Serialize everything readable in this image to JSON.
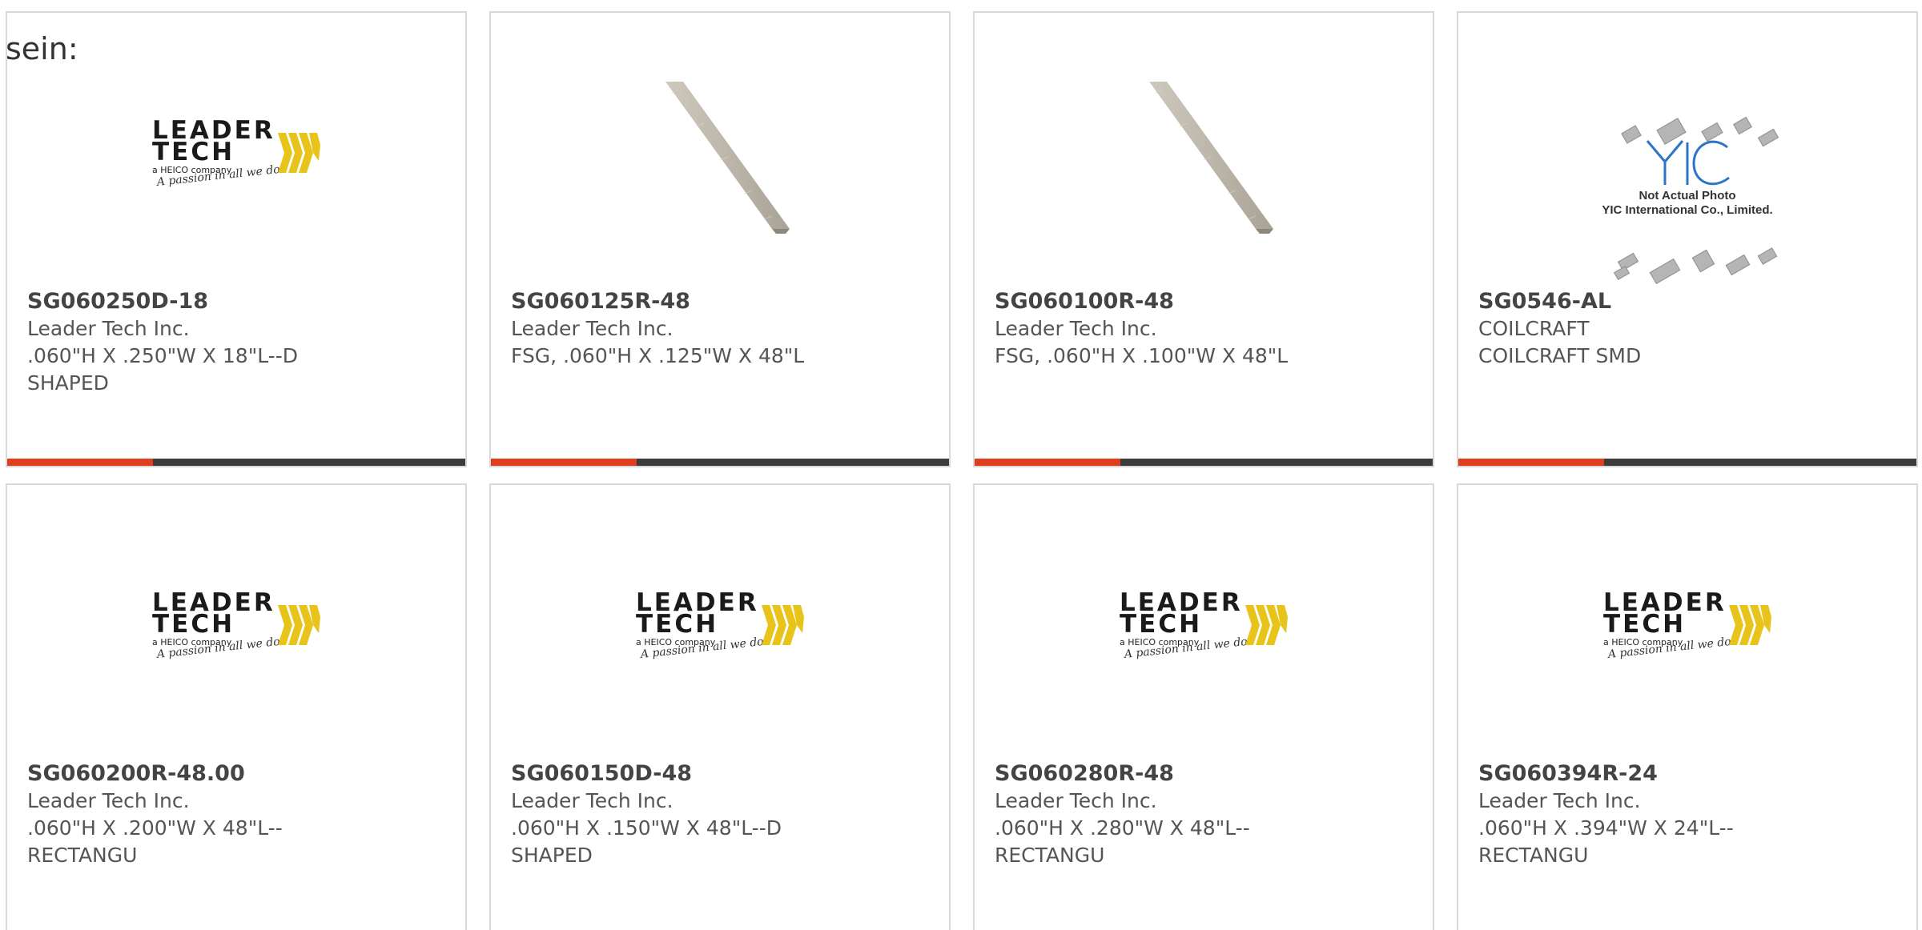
{
  "intro": {
    "text": "sein:"
  },
  "logo_text": {
    "leadertech_line1": "LEADER",
    "leadertech_line2": "TECH",
    "leadertech_sub": "a HEICO company",
    "leadertech_tagline": "A passion in all we do",
    "yic_caption_1": "Not Actual Photo",
    "yic_caption_2": "YIC International Co., Limited."
  },
  "colors": {
    "accent": "#e03e1c",
    "bar_dark": "#3c3c3c",
    "logo_gold": "#e8c31a",
    "yic_blue": "#2b74c6"
  },
  "products": [
    {
      "part": "SG060250D-18",
      "maker": "Leader Tech Inc.",
      "desc": ".060\"H X .250\"W X 18\"L--D\nSHAPED",
      "image": "leadertech-logo"
    },
    {
      "part": "SG060125R-48",
      "maker": "Leader Tech Inc.",
      "desc": "FSG, .060\"H X .125\"W X 48\"L",
      "image": "gasket-strip"
    },
    {
      "part": "SG060100R-48",
      "maker": "Leader Tech Inc.",
      "desc": "FSG, .060\"H X .100\"W X 48\"L",
      "image": "gasket-strip"
    },
    {
      "part": "SG0546-AL",
      "maker": "COILCRAFT",
      "desc": "COILCRAFT SMD",
      "image": "yic-placeholder"
    },
    {
      "part": "SG060200R-48.00",
      "maker": "Leader Tech Inc.",
      "desc": ".060\"H X .200\"W X 48\"L--\nRECTANGU",
      "image": "leadertech-logo"
    },
    {
      "part": "SG060150D-48",
      "maker": "Leader Tech Inc.",
      "desc": ".060\"H X .150\"W X 48\"L--D\nSHAPED",
      "image": "leadertech-logo"
    },
    {
      "part": "SG060280R-48",
      "maker": "Leader Tech Inc.",
      "desc": ".060\"H X .280\"W X 48\"L--\nRECTANGU",
      "image": "leadertech-logo"
    },
    {
      "part": "SG060394R-24",
      "maker": "Leader Tech Inc.",
      "desc": ".060\"H X .394\"W X 24\"L--\nRECTANGU",
      "image": "leadertech-logo"
    }
  ]
}
